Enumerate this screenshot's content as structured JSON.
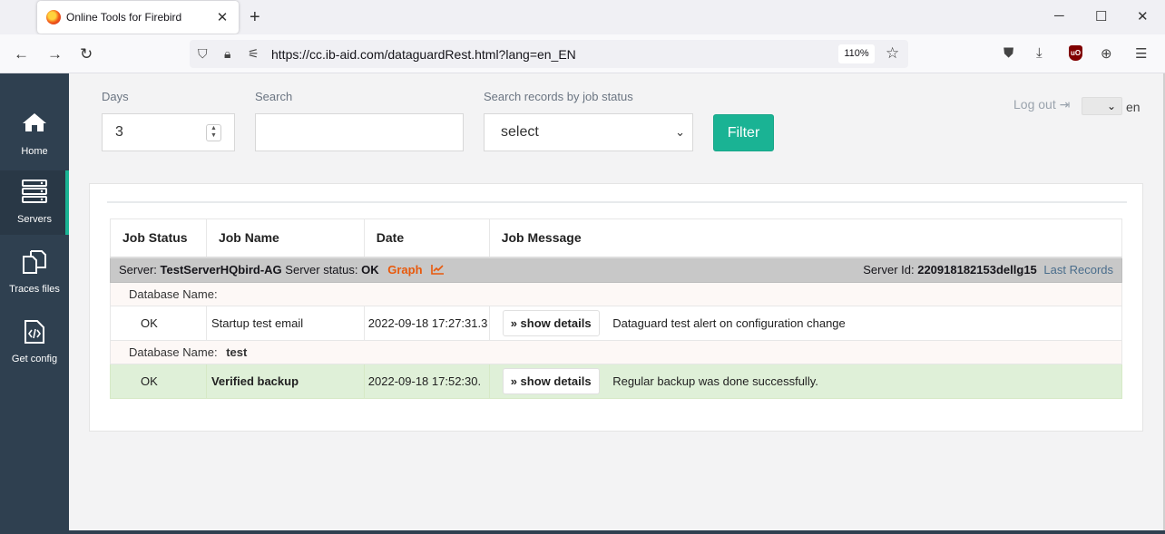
{
  "browser": {
    "tab_title": "Online Tools for Firebird",
    "url": "https://cc.ib-aid.com/dataguardRest.html?lang=en_EN",
    "zoom": "110%"
  },
  "sidebar": {
    "items": [
      {
        "label": "Home",
        "icon": "home-icon"
      },
      {
        "label": "Servers",
        "icon": "servers-icon",
        "active": true
      },
      {
        "label": "Traces files",
        "icon": "files-icon"
      },
      {
        "label": "Get config",
        "icon": "code-file-icon"
      }
    ]
  },
  "filters": {
    "days_label": "Days",
    "days_value": "3",
    "search_label": "Search",
    "search_value": "",
    "status_label": "Search records by job status",
    "status_value": "select",
    "filter_button": "Filter"
  },
  "header": {
    "logout": "Log out",
    "lang": "en"
  },
  "table": {
    "columns": [
      "Job Status",
      "Job Name",
      "Date",
      "Job Message"
    ],
    "server": {
      "server_label": "Server:",
      "server_name": "TestServerHQbird-AG",
      "status_label": "Server status:",
      "status_value": "OK",
      "graph_label": "Graph",
      "id_label": "Server Id:",
      "id_value": "220918182153dellg15",
      "last_records": "Last Records"
    },
    "groups": [
      {
        "db_label": "Database Name:",
        "db_name": "",
        "rows": [
          {
            "status": "OK",
            "name": "Startup test email",
            "date": "2022-09-18 17:27:31.3",
            "details": "show details",
            "message": "Dataguard test alert on configuration change"
          }
        ]
      },
      {
        "db_label": "Database Name:",
        "db_name": "test",
        "rows": [
          {
            "status": "OK",
            "name": "Verified backup",
            "date": "2022-09-18 17:52:30.",
            "details": "show details",
            "message": "Regular backup was done successfully."
          }
        ]
      }
    ]
  },
  "colors": {
    "sidebar": "#2f4050",
    "accent": "#1ab394",
    "graph_link": "#e8590c",
    "success_row": "#dff0d8"
  }
}
